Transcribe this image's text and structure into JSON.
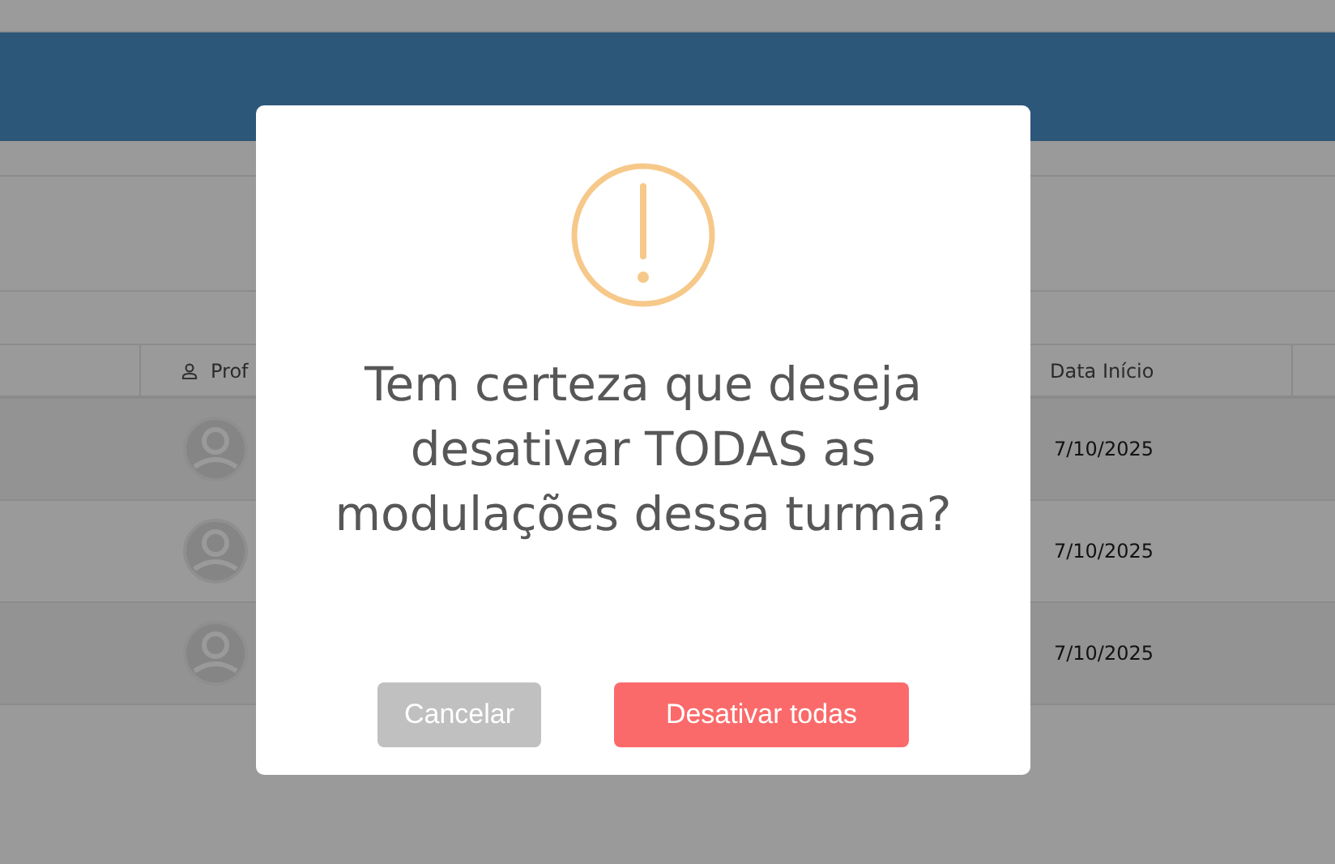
{
  "table": {
    "columns": [
      {
        "label": "Prof"
      },
      {
        "label": "Data Início"
      }
    ],
    "rows": [
      {
        "date": "7/10/2025"
      },
      {
        "date": "7/10/2025"
      },
      {
        "date": "7/10/2025"
      }
    ]
  },
  "dialog": {
    "message": "Tem certeza que deseja desativar TODAS as modulações dessa turma?",
    "buttons": [
      {
        "label": "Cancelar",
        "kind": "cancel"
      },
      {
        "label": "Desativar todas",
        "kind": "danger"
      }
    ]
  }
}
